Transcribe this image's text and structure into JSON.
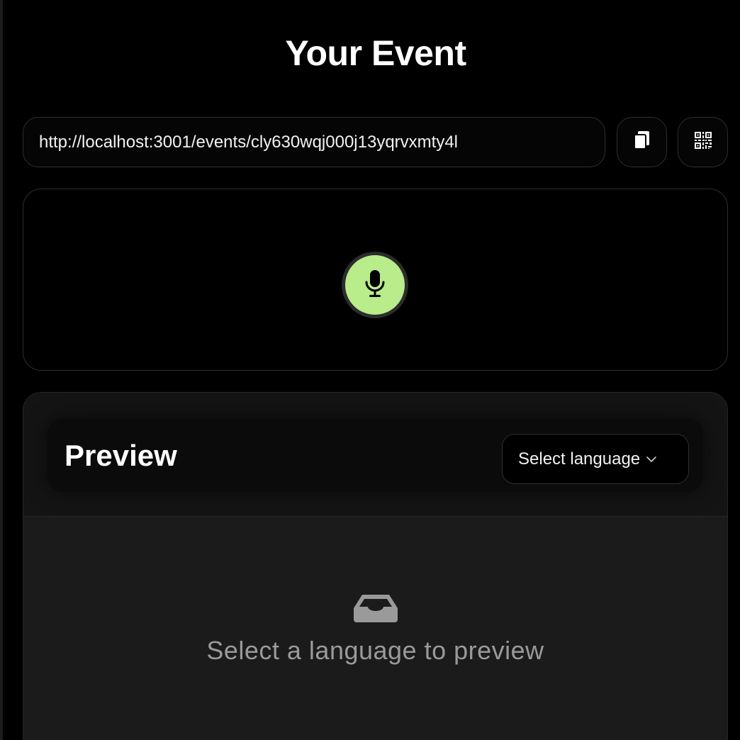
{
  "page": {
    "title": "Your Event"
  },
  "share": {
    "event_url": "http://localhost:3001/events/cly630wqj000j13yqrvxmty4l",
    "copy_icon": "copy-icon",
    "qr_icon": "qr-code-icon"
  },
  "recorder": {
    "mic_icon": "microphone-icon",
    "accent_color": "#b9ec8a"
  },
  "preview": {
    "title": "Preview",
    "language_select": {
      "selected": "Select language",
      "icon": "chevron-down-icon"
    },
    "empty_state": {
      "icon": "inbox-icon",
      "message": "Select a language to preview"
    }
  },
  "colors": {
    "background": "#000000",
    "card": "#1b1b1b",
    "muted_text": "#9a9a9a"
  }
}
